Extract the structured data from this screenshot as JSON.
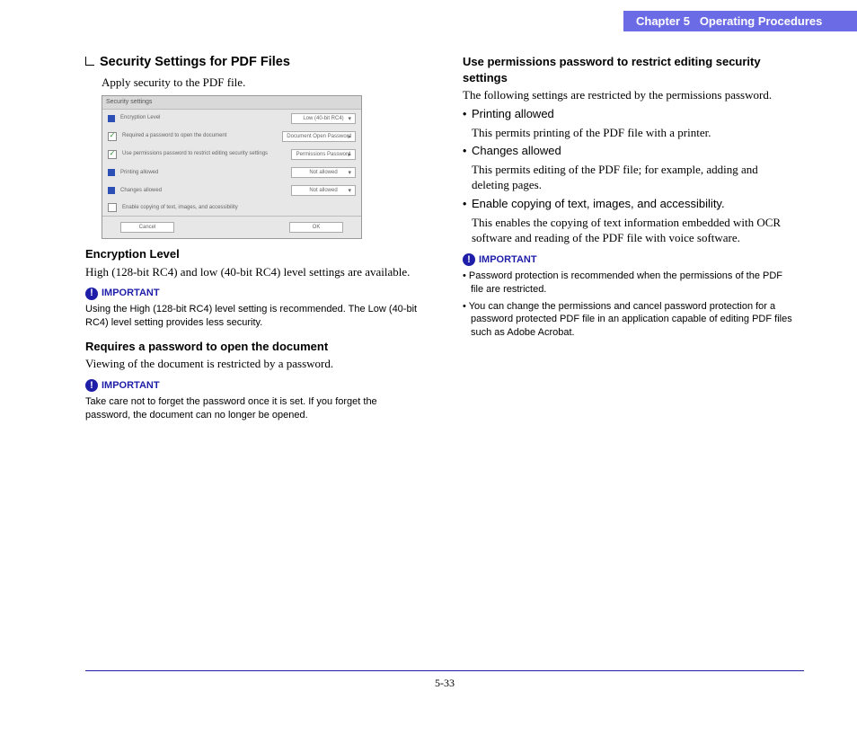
{
  "header": {
    "chapter": "Chapter 5",
    "title": "Operating Procedures"
  },
  "left": {
    "heading": "Security Settings for PDF Files",
    "intro": "Apply security to the PDF file.",
    "ss": {
      "title": "Security settings",
      "row1_label": "Encryption Level",
      "row1_btn": "Low (40-bit RC4)",
      "row2_label": "Required a password to open the document",
      "row2_btn": "Document Open Password",
      "row3_label": "Use permissions password to restrict editing security settings",
      "row3_btn": "Permissions Password",
      "row4_label": "Printing allowed",
      "row4_btn": "Not allowed",
      "row5_label": "Changes allowed",
      "row5_btn": "Not allowed",
      "row6_label": "Enable copying of text, images, and accessibility",
      "cancel": "Cancel",
      "ok": "OK"
    },
    "enc_heading": "Encryption Level",
    "enc_body": "High (128-bit RC4) and low (40-bit RC4) level settings are available.",
    "imp1": "Using the High (128-bit RC4) level setting is recommended. The Low (40-bit RC4) level setting provides less security.",
    "req_heading": "Requires a password to open the document",
    "req_body": "Viewing of the document is restricted by a password.",
    "imp2": "Take care not to forget the password once it is set. If you forget the password, the document can no longer be opened."
  },
  "right": {
    "heading": "Use permissions password to restrict editing security settings",
    "intro": "The following settings are restricted by the permissions password.",
    "b1_title": "Printing allowed",
    "b1_body": "This permits printing of the PDF file with a printer.",
    "b2_title": "Changes allowed",
    "b2_body": "This permits editing of the PDF file; for example, adding and deleting pages.",
    "b3_title": "Enable copying of text, images, and accessibility.",
    "b3_body": "This enables the copying of text information embedded with OCR software and reading of the PDF file with voice software.",
    "imp_b1": "Password protection is recommended when the permissions of the PDF file are restricted.",
    "imp_b2": "You can change the permissions and cancel password protection for a password protected PDF file in an application capable of editing PDF files such as Adobe Acrobat."
  },
  "labels": {
    "important": "IMPORTANT"
  },
  "footer": {
    "page": "5-33"
  }
}
